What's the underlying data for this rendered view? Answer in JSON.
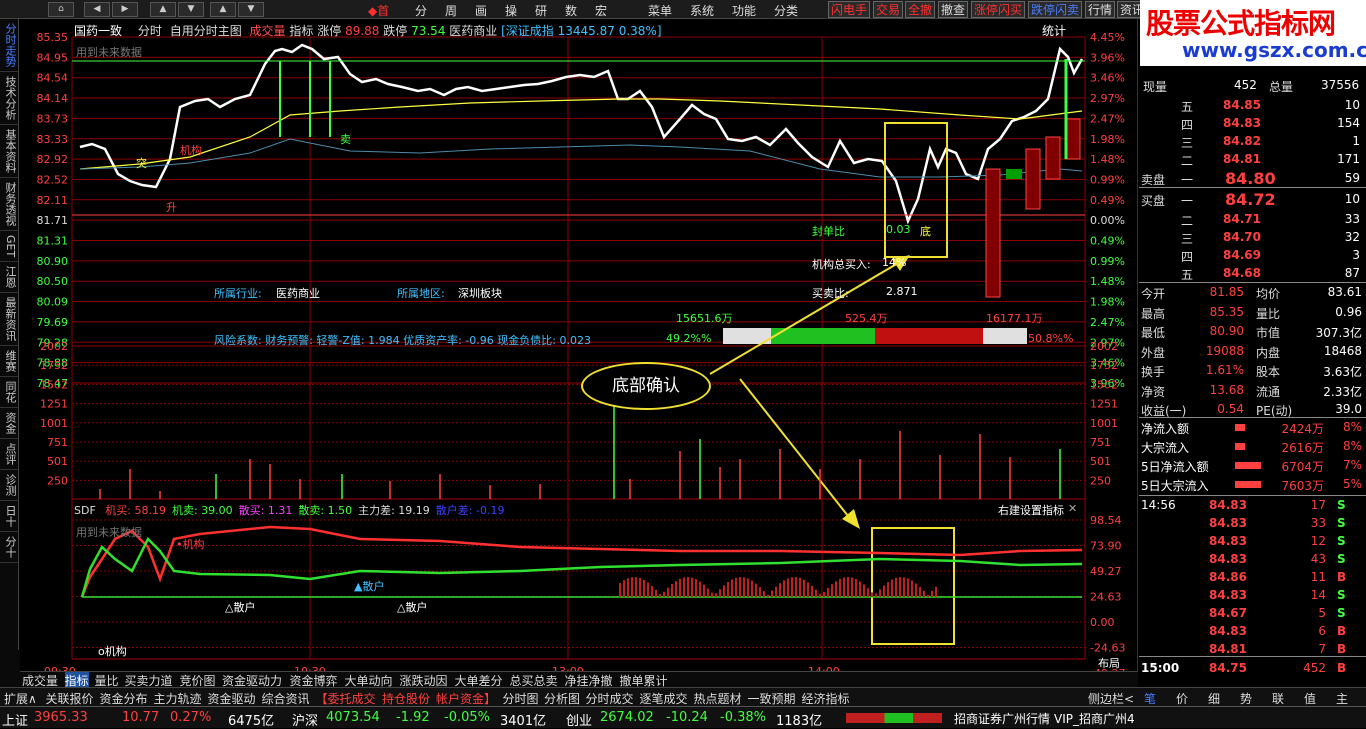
{
  "toolbar": {
    "nav_home": "首",
    "menu": [
      "分",
      "周",
      "画",
      "操",
      "研",
      "数",
      "宏"
    ],
    "menu2": [
      "菜单",
      "系统",
      "功能",
      "分类"
    ],
    "quick": [
      "闪电手",
      "交易",
      "全撤",
      "撤查",
      "涨停闪买",
      "跌停闪卖",
      "行情",
      "资讯"
    ]
  },
  "watermark": {
    "line1": "股票公式指标网",
    "line2": "www.gszx.com.cn"
  },
  "leftnav": [
    {
      "label": "分时走势",
      "active": true
    },
    {
      "label": "技术分析",
      "active": false
    },
    {
      "label": "基本资料",
      "active": false
    },
    {
      "label": "财务透视",
      "active": false
    },
    {
      "label": "GET",
      "active": false
    },
    {
      "label": "江恩",
      "active": false
    },
    {
      "label": "最新资讯",
      "active": false
    },
    {
      "label": "维赛",
      "active": false
    },
    {
      "label": "同花",
      "active": false
    },
    {
      "label": "资金",
      "active": false
    },
    {
      "label": "点评",
      "active": false
    },
    {
      "label": "诊测",
      "active": false
    },
    {
      "label": "日十",
      "active": false
    },
    {
      "label": "分十",
      "active": false
    }
  ],
  "header": {
    "name": "国药一致",
    "items": [
      "分时",
      "自用分时主图"
    ],
    "vol_label": "成交量",
    "ind_label": "指标",
    "up_label": "涨停",
    "up_val": "89.88",
    "down_label": "跌停",
    "down_val": "73.54",
    "sector": "医药商业",
    "index": "[深证成指 13445.87 0.38%]",
    "stat": "统计"
  },
  "chart_text": {
    "future_note": "用到未来数据",
    "industry_label": "所属行业:",
    "industry": "医药商业",
    "region_label": "所属地区:",
    "region": "深圳板块",
    "risk": "风险系数: 财务预警: 轻警-Z值: 1.984 优质资产率: -0.96 现金负债比: 0.023",
    "seal_label": "封单比",
    "seal_val": "0.03",
    "inst_label": "机构总买入:",
    "inst_val": "14%",
    "ratio_label": "买卖比:",
    "ratio_val": "2.871",
    "buy_amt": "15651.6万",
    "mid_amt": "525.4万",
    "sell_amt": "16177.1万",
    "buy_pct": "49.2%%",
    "sell_pct": "50.8%%",
    "sig_ji": "机构",
    "sig_sheng": "升",
    "sig_mai": "卖",
    "sig_di": "底",
    "sig_tu": "突",
    "annotation": "底部确认",
    "sdf_label": "SDF",
    "sdf_items": [
      {
        "t": "机买: 58.19",
        "c": "#ff4040"
      },
      {
        "t": "机卖: 39.00",
        "c": "#40ff40"
      },
      {
        "t": "散买: 1.31",
        "c": "#ff40ff"
      },
      {
        "t": "散卖: 1.50",
        "c": "#40ff40"
      },
      {
        "t": "主力差: 19.19",
        "c": "#ddd"
      },
      {
        "t": "散户差: -0.19",
        "c": "#4040ff"
      }
    ],
    "right_setting": "右建设置指标",
    "sanhu": "△散户",
    "sanhu2": "△散户",
    "jigou_lo": "o机构",
    "jigou_sdf": "•机构",
    "sanhu_up": "▲散户",
    "layout": "布局"
  },
  "price_axis": {
    "left": [
      "85.35",
      "84.95",
      "84.54",
      "84.14",
      "83.73",
      "83.33",
      "82.92",
      "82.52",
      "82.11",
      "81.71",
      "81.31",
      "80.90",
      "80.50",
      "80.09",
      "79.69",
      "79.28",
      "78.88",
      "78.47"
    ],
    "right": [
      "4.45%",
      "3.96%",
      "3.46%",
      "2.97%",
      "2.47%",
      "1.98%",
      "1.48%",
      "0.99%",
      "0.49%",
      "0.00%",
      "0.49%",
      "0.99%",
      "1.48%",
      "1.98%",
      "2.47%",
      "2.97%",
      "3.46%",
      "3.96%"
    ]
  },
  "vol_axis": [
    "2002",
    "1752",
    "1502",
    "1251",
    "1001",
    "751",
    "501",
    "250"
  ],
  "sdf_axis": [
    "98.54",
    "73.90",
    "49.27",
    "24.63",
    "0.00",
    "-24.63",
    "-49.27"
  ],
  "time_axis": [
    "09:30",
    "10:30",
    "13:00",
    "14:00"
  ],
  "quote": {
    "now_label": "现量",
    "now_val": "452",
    "total_label": "总量",
    "total_val": "37556",
    "asks": [
      {
        "l": "五",
        "p": "84.85",
        "v": "10"
      },
      {
        "l": "四",
        "p": "84.83",
        "v": "154"
      },
      {
        "l": "三",
        "p": "84.82",
        "v": "1"
      },
      {
        "l": "二",
        "p": "84.81",
        "v": "171"
      },
      {
        "l": "一",
        "p": "84.80",
        "v": "59"
      }
    ],
    "bids": [
      {
        "l": "一",
        "p": "84.72",
        "v": "10"
      },
      {
        "l": "二",
        "p": "84.71",
        "v": "33"
      },
      {
        "l": "三",
        "p": "84.70",
        "v": "32"
      },
      {
        "l": "四",
        "p": "84.69",
        "v": "3"
      },
      {
        "l": "五",
        "p": "84.68",
        "v": "87"
      }
    ],
    "sell_label": "卖盘",
    "buy_label": "买盘",
    "stats": [
      [
        "今开",
        "81.85",
        "均价",
        "83.61"
      ],
      [
        "最高",
        "85.35",
        "量比",
        "0.96"
      ],
      [
        "最低",
        "80.90",
        "市值",
        "307.3亿"
      ],
      [
        "外盘",
        "19088",
        "内盘",
        "18468"
      ],
      [
        "换手",
        "1.61%",
        "股本",
        "3.63亿"
      ],
      [
        "净资",
        "13.68",
        "流通",
        "2.33亿"
      ],
      [
        "收益(一)",
        "0.54",
        "PE(动)",
        "39.0"
      ]
    ],
    "flows": [
      [
        "净流入额",
        "2424万",
        "8%"
      ],
      [
        "大宗流入",
        "2616万",
        "8%"
      ],
      [
        "5日净流入额",
        "6704万",
        "7%"
      ],
      [
        "5日大宗流入",
        "7603万",
        "5%"
      ]
    ],
    "ticks_time": "14:56",
    "ticks": [
      [
        "84.83",
        "17",
        "S"
      ],
      [
        "84.83",
        "33",
        "S"
      ],
      [
        "84.83",
        "12",
        "S"
      ],
      [
        "84.83",
        "43",
        "S"
      ],
      [
        "84.86",
        "11",
        "B"
      ],
      [
        "84.83",
        "14",
        "S"
      ],
      [
        "84.67",
        "5",
        "S"
      ],
      [
        "84.83",
        "6",
        "B"
      ],
      [
        "84.81",
        "7",
        "B"
      ]
    ],
    "last_time": "15:00",
    "last_price": "84.75",
    "last_vol": "452",
    "last_side": "B"
  },
  "bottom_tabs": [
    "成交量",
    "指标",
    "量比",
    "买卖力道",
    "竞价图",
    "资金驱动力",
    "资金博弈",
    "大单动向",
    "涨跌动因",
    "大单差分",
    "总买总卖",
    "净挂净撤",
    "撤单累计"
  ],
  "bottom_tabs2": [
    "扩展∧",
    "关联报价",
    "资金分布",
    "主力轨迹",
    "资金驱动",
    "综合资讯",
    "【委托成交",
    "持仓股份",
    "帐户资金】",
    "分时图",
    "分析图",
    "分时成交",
    "逐笔成交",
    "热点题材",
    "一致预期",
    "经济指标",
    "侧边栏<"
  ],
  "right_tabs": [
    "笔",
    "价",
    "细",
    "势",
    "联",
    "值",
    "主"
  ],
  "status": {
    "sh_label": "上证",
    "sh": "3965.33",
    "sh_chg": "10.77",
    "sh_pct": "0.27%",
    "sh_amt": "6475亿",
    "hs_label": "沪深",
    "hs": "4073.54",
    "hs_chg": "-1.92",
    "hs_pct": "-0.05%",
    "hs_amt": "3401亿",
    "cy_label": "创业",
    "cy": "2674.02",
    "cy_chg": "-10.24",
    "cy_pct": "-0.38%",
    "cy_amt": "1183亿",
    "broker": "招商证券广州行情",
    "vip": "VIP_招商广州4"
  },
  "colors": {
    "up": "#ff3232",
    "down": "#00e000",
    "price_line": "#ffffff",
    "avg_line": "#ffff00",
    "grid": "#8b0000"
  }
}
